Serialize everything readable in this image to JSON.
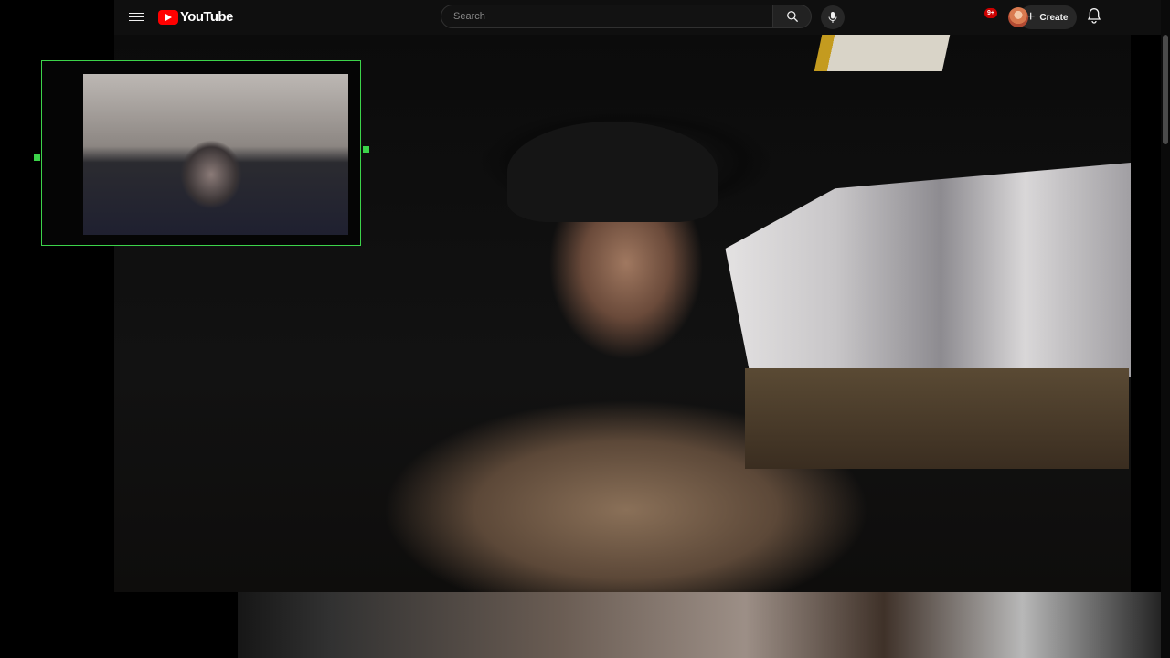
{
  "app": {
    "logo_text": "YouTube",
    "brand_color": "#ff0000"
  },
  "masthead": {
    "menu_icon": "hamburger-menu-icon",
    "search": {
      "placeholder": "Search",
      "value": ""
    },
    "search_icon": "search-icon",
    "mic_icon": "microphone-icon",
    "create_label": "Create",
    "notifications_badge": "9+",
    "avatar_icon": "user-avatar"
  },
  "webcam_overlay": {
    "border_color": "#3cd34a"
  }
}
